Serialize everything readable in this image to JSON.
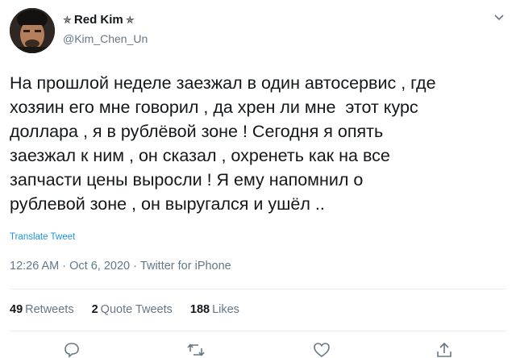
{
  "author": {
    "display_name": "Red Kim",
    "star_left": "✯",
    "star_right": "✯",
    "handle": "@Kim_Chen_Un"
  },
  "tweet": {
    "text": "На прошлой неделе заезжал в один автосервис , где\nхозяин его мне говорил , да хрен ли мне  этот курс\nдоллара , я в рублёвой зоне ! Сегодня я опять\nзаезжал к ним , он сказал , охренеть как на все\nзапчасти цены выросли ! Я ему напомнил о\nрублевой зоне , он выругался и ушёл ..",
    "translate_label": "Translate Tweet"
  },
  "meta": {
    "time": "12:26 AM",
    "separator": "·",
    "date": "Oct 6, 2020",
    "source": "Twitter for iPhone"
  },
  "stats": {
    "retweets_count": "49",
    "retweets_label": "Retweets",
    "quotes_count": "2",
    "quotes_label": "Quote Tweets",
    "likes_count": "188",
    "likes_label": "Likes"
  },
  "icons": {
    "reply": "reply-icon",
    "retweet": "retweet-icon",
    "like": "heart-icon",
    "share": "share-icon",
    "more": "chevron-down-icon"
  },
  "colors": {
    "link": "#1b95e0",
    "secondary_text": "#657786",
    "divider": "#e6ecf0"
  }
}
